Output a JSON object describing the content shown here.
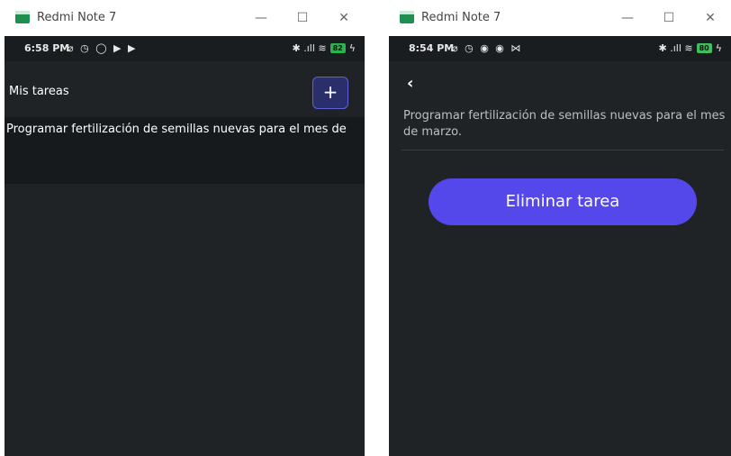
{
  "left_window": {
    "title": "Redmi Note 7",
    "status": {
      "time": "6:58 PM",
      "icons": "⌀ ◷ ◯ ▶ ▶",
      "signal": "✱ .ıll ≋",
      "battery": "82",
      "charging": "ϟ"
    },
    "appbar": {
      "title": "Mis tareas",
      "add_label": "+"
    },
    "tasks": [
      {
        "text": "Programar fertilización de semillas nuevas para el mes de"
      }
    ]
  },
  "right_window": {
    "title": "Redmi Note 7",
    "status": {
      "time": "8:54 PM",
      "icons": "⌀ ◷ ◉ ◉ ⋈",
      "signal": "✱ .ıll ≋",
      "battery": "80",
      "charging": "ϟ"
    },
    "back_label": "‹",
    "task_detail": "Programar fertilización de semillas nuevas para el mes de marzo.",
    "delete_label": "Eliminar tarea"
  },
  "window_controls": {
    "minimize": "—",
    "maximize": "☐",
    "close": "✕"
  },
  "colors": {
    "accent": "#5548ea",
    "app_bg": "#1f2326",
    "icon_green": "#1e8f4e"
  }
}
